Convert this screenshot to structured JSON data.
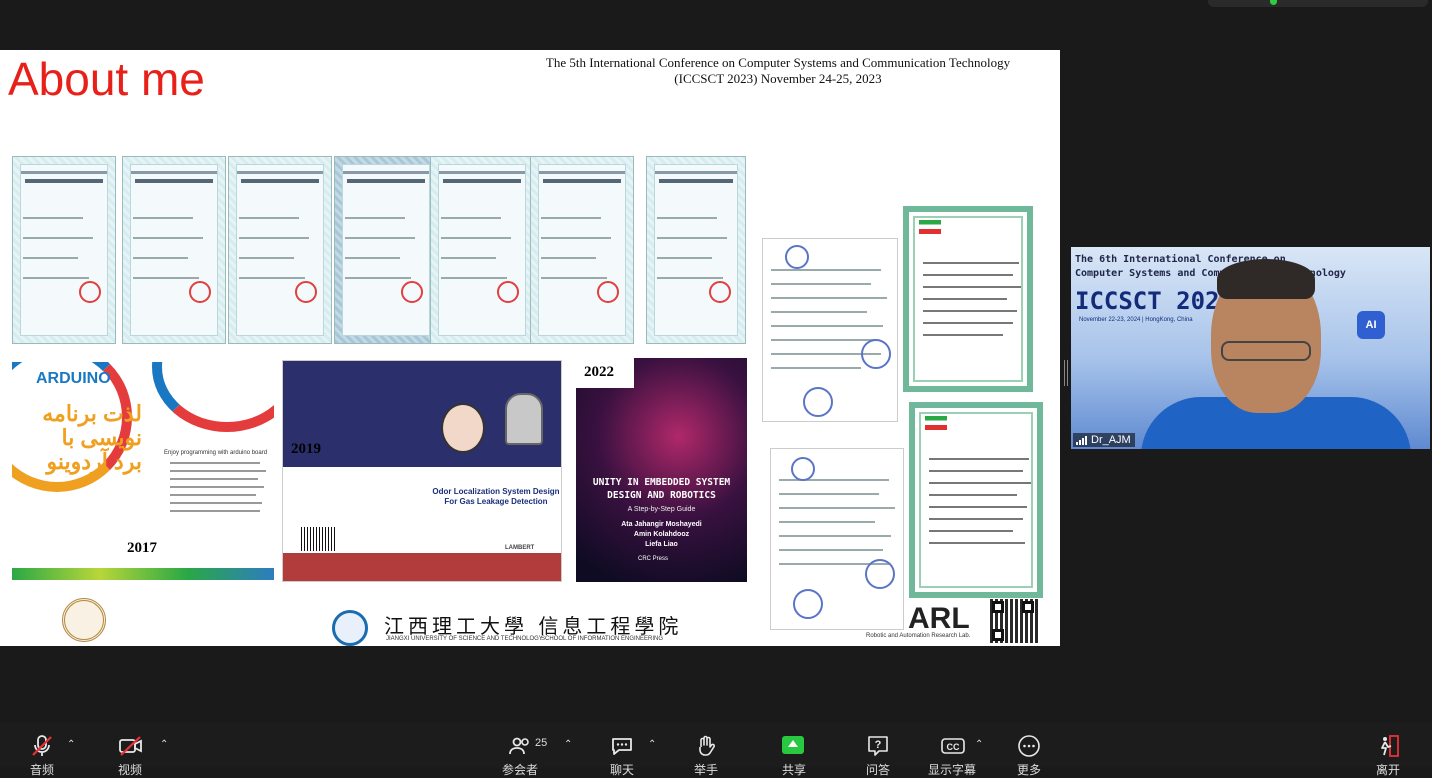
{
  "slide": {
    "title": "About me",
    "conference_line1": "The 5th International Conference on Computer Systems and Communication Technology",
    "conference_line2": "(ICCSCT 2023)  November 24-25, 2023",
    "book1": {
      "year": "2017",
      "top_label": "ARDUINO",
      "title_fa": "لذت برنامه نویسی با برد آردوینو",
      "subtitle": "Enjoy programming with arduino board"
    },
    "book2": {
      "year": "2019",
      "title": "Odor Localization System Design For Gas Leakage Detection",
      "publisher": "LAMBERT"
    },
    "book3": {
      "year": "2022",
      "title_line1": "UNITY IN EMBEDDED SYSTEM",
      "title_line2": "DESIGN AND ROBOTICS",
      "subtitle": "A Step-by-Step Guide",
      "authors": [
        "Ata Jahangir Moshayedi",
        "Amin Kolahdooz",
        "Liefa Liao"
      ],
      "publisher": "CRC Press"
    },
    "university_cn": "江西理工大學 信息工程學院",
    "university_en": "JIANGXI UNIVERSITY OF SCIENCE AND TECHNOLOGY",
    "school_en": "SCHOOL OF INFORMATION ENGINEERING",
    "lab_short": "ARL",
    "lab_full": "Robotic and Automation Research Lab."
  },
  "video": {
    "banner_line1": "The 6th International Conference on",
    "banner_line2": "Computer Systems and Communication Technology",
    "banner_big": "ICCSCT 2024",
    "banner_date": "November 22-23, 2024 | HongKong, China",
    "badge": "AI",
    "participant_name": "Dr_AJM"
  },
  "toolbar": {
    "mute_label": "音频",
    "video_label": "视频",
    "participants_label": "参会者",
    "participants_count": "25",
    "chat_label": "聊天",
    "raise_hand_label": "举手",
    "share_label": "共享",
    "qa_label": "问答",
    "captions_label": "显示字幕",
    "more_label": "更多",
    "leave_label": "离开"
  },
  "icons": [
    "mic-muted-icon",
    "video-off-icon",
    "participants-icon",
    "chat-icon",
    "raise-hand-icon",
    "share-screen-icon",
    "qa-icon",
    "captions-icon",
    "more-icon",
    "leave-icon"
  ],
  "colors": {
    "slide_title": "#e8201a",
    "share_green": "#28c840",
    "toolbar_bg": "#1c1c1c",
    "muted_red": "#e8303a"
  }
}
